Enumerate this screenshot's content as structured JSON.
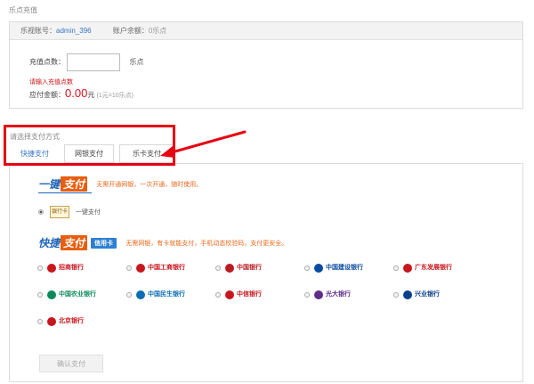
{
  "page_title": "乐点充值",
  "account": {
    "account_label": "乐视账号：",
    "account_value": "admin_396",
    "balance_label": "账户余额：",
    "balance_value": "0乐点"
  },
  "recharge": {
    "amount_label": "充值点数：",
    "amount_value": "",
    "amount_placeholder": "",
    "amount_unit": "乐点",
    "error_text": "请输入充值点数",
    "payable_label": "应付金额：",
    "payable_amount": "0.00",
    "payable_currency": "元",
    "rate_note": "(1元=10乐点)"
  },
  "payment": {
    "section_label": "请选择支付方式",
    "tabs": [
      {
        "label": "快捷支付",
        "active": true
      },
      {
        "label": "网银支付",
        "active": false
      },
      {
        "label": "乐卡支付",
        "active": false
      }
    ],
    "onekey": {
      "logo_text": "一键",
      "logo_chip": "支付",
      "slogan": "无需开通网银，一次开通，随时使用。",
      "card_icon_text": "银行卡",
      "option_label": "一键支付"
    },
    "quick": {
      "logo_text": "快捷",
      "logo_chip": "支付",
      "badge": "信用卡",
      "slogan": "无需网银，有卡就能支付，手机动态校验码，支付更安全。"
    },
    "banks": [
      {
        "name": "招商银行",
        "color": "#c8161d",
        "icon": "cmb-logo-icon"
      },
      {
        "name": "中国工商银行",
        "color": "#c8161d",
        "icon": "icbc-logo-icon"
      },
      {
        "name": "中国银行",
        "color": "#b81c22",
        "icon": "boc-logo-icon"
      },
      {
        "name": "中国建设银行",
        "color": "#0a4b9e",
        "icon": "ccb-logo-icon"
      },
      {
        "name": "广东发展银行",
        "color": "#c8161d",
        "icon": "cgb-logo-icon"
      },
      {
        "name": "中国农业银行",
        "color": "#0a8a5a",
        "icon": "abc-logo-icon"
      },
      {
        "name": "中国民生银行",
        "color": "#0a6db3",
        "icon": "cmbc-logo-icon"
      },
      {
        "name": "中信银行",
        "color": "#c8161d",
        "icon": "citic-logo-icon"
      },
      {
        "name": "光大银行",
        "color": "#5d2d8c",
        "icon": "ceb-logo-icon"
      },
      {
        "name": "兴业银行",
        "color": "#0a3f8c",
        "icon": "cib-logo-icon"
      },
      {
        "name": "北京银行",
        "color": "#c8161d",
        "icon": "bob-logo-icon"
      }
    ],
    "confirm_label": "确认支付"
  },
  "colors": {
    "highlight": "#e60012",
    "link": "#3a77c2",
    "price": "#d9131d"
  }
}
